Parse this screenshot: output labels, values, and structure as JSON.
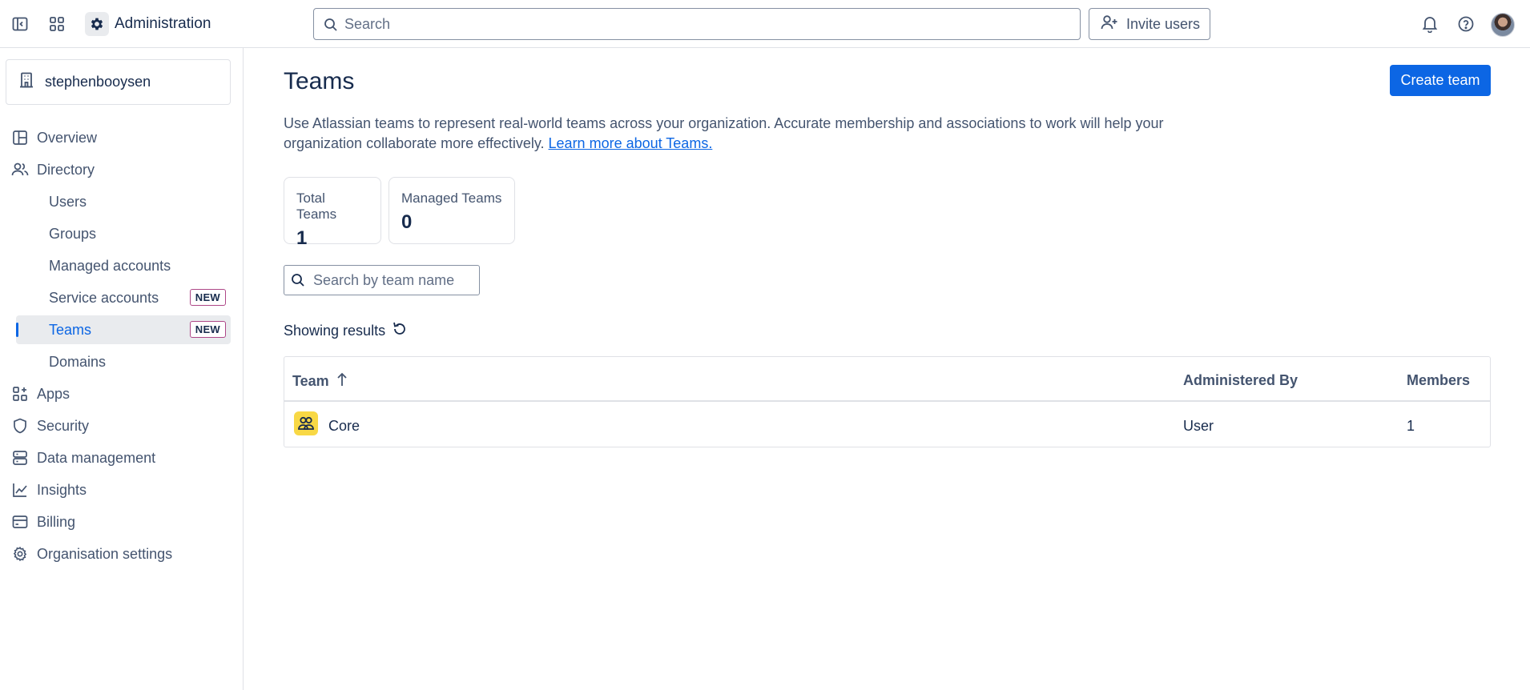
{
  "topbar": {
    "app_title": "Administration",
    "search_placeholder": "Search",
    "invite_label": "Invite users"
  },
  "sidebar": {
    "org_name": "stephenbooysen",
    "items": [
      {
        "label": "Overview",
        "icon": "overview-icon"
      },
      {
        "label": "Directory",
        "icon": "people-icon"
      },
      {
        "label": "Users"
      },
      {
        "label": "Groups"
      },
      {
        "label": "Managed accounts"
      },
      {
        "label": "Service accounts",
        "badge": "NEW"
      },
      {
        "label": "Teams",
        "badge": "NEW",
        "active": true
      },
      {
        "label": "Domains"
      },
      {
        "label": "Apps",
        "icon": "apps-icon"
      },
      {
        "label": "Security",
        "icon": "shield-icon"
      },
      {
        "label": "Data management",
        "icon": "database-icon"
      },
      {
        "label": "Insights",
        "icon": "chart-line-icon"
      },
      {
        "label": "Billing",
        "icon": "credit-card-icon"
      },
      {
        "label": "Organisation settings",
        "icon": "gear-icon"
      }
    ]
  },
  "main": {
    "title": "Teams",
    "create_button": "Create team",
    "description": "Use Atlassian teams to represent real-world teams across your organization. Accurate membership and associations to work will help your organization collaborate more effectively.",
    "learn_more": "Learn more about Teams.",
    "stats": [
      {
        "label": "Total Teams",
        "value": "1"
      },
      {
        "label": "Managed Teams",
        "value": "0"
      }
    ],
    "team_search_placeholder": "Search by team name",
    "showing_results": "Showing results",
    "table": {
      "columns": [
        "Team",
        "Administered By",
        "Members"
      ],
      "rows": [
        {
          "team": "Core",
          "administered_by": "User",
          "members": "1"
        }
      ]
    }
  },
  "colors": {
    "accent": "#0c66e4",
    "text": "#172b4d",
    "subtle_text": "#44546f",
    "border": "#dfe1e6",
    "new_badge_border": "#ae4787",
    "team_avatar": "#f8d845"
  }
}
